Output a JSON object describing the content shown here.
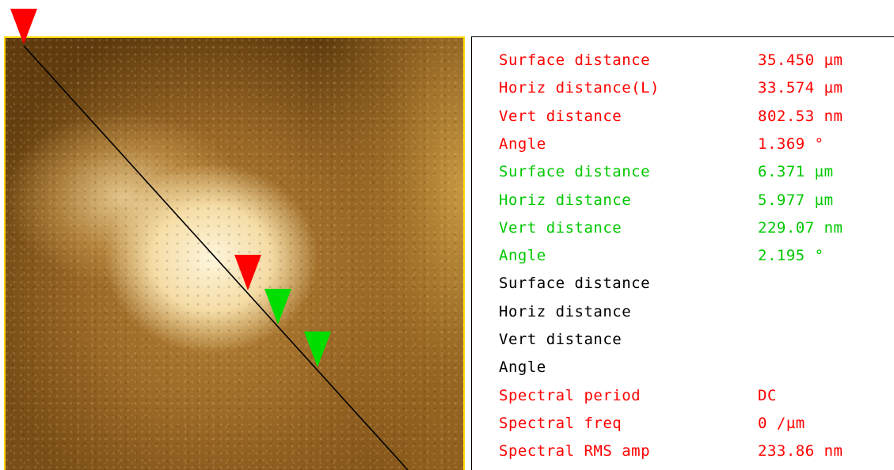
{
  "colors": {
    "red_group": "#ff0000",
    "green_group": "#00c800",
    "black_group": "#000000",
    "image_border": "#ffd700",
    "section_line": "#000000"
  },
  "image": {
    "markers": [
      {
        "name": "red-cursor-start-marker",
        "color": "red"
      },
      {
        "name": "red-cursor-mid-marker",
        "color": "red"
      },
      {
        "name": "green-cursor-start-marker",
        "color": "green"
      },
      {
        "name": "green-cursor-end-marker",
        "color": "green"
      }
    ]
  },
  "panel": {
    "rows": [
      {
        "label": "Surface distance",
        "value": "35.450 µm",
        "color": "red"
      },
      {
        "label": "Horiz distance(L)",
        "value": "33.574 µm",
        "color": "red"
      },
      {
        "label": "Vert distance",
        "value": "802.53 nm",
        "color": "red"
      },
      {
        "label": "Angle",
        "value": "1.369 °",
        "color": "red"
      },
      {
        "label": "Surface distance",
        "value": "6.371 µm",
        "color": "green"
      },
      {
        "label": "Horiz distance",
        "value": "5.977 µm",
        "color": "green"
      },
      {
        "label": "Vert distance",
        "value": "229.07 nm",
        "color": "green"
      },
      {
        "label": "Angle",
        "value": "2.195 °",
        "color": "green"
      },
      {
        "label": "Surface distance",
        "value": "",
        "color": "black"
      },
      {
        "label": "Horiz distance",
        "value": "",
        "color": "black"
      },
      {
        "label": "Vert distance",
        "value": "",
        "color": "black"
      },
      {
        "label": "Angle",
        "value": "",
        "color": "black"
      },
      {
        "label": "Spectral period",
        "value": "DC",
        "color": "red"
      },
      {
        "label": "Spectral freq",
        "value": "0 /µm",
        "color": "red"
      },
      {
        "label": "Spectral RMS amp",
        "value": "233.86 nm",
        "color": "red"
      }
    ]
  }
}
